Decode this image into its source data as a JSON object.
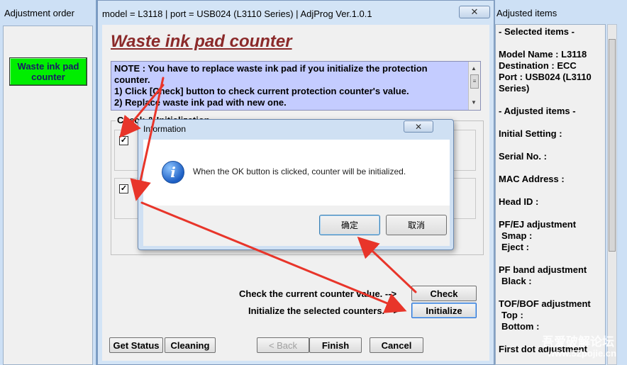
{
  "left_window": {
    "title": "Adjustment order",
    "button_label": "Waste ink pad counter"
  },
  "main_window": {
    "title": "model = L3118 | port = USB024 (L3110 Series) | AdjProg Ver.1.0.1",
    "close_symbol": "✕",
    "heading": "Waste ink pad counter",
    "note_lines": [
      "NOTE : You have to replace waste ink pad if you initialize the protection",
      "counter.",
      "1) Click [Check] button to check current protection counter's value.",
      "2) Replace waste ink pad with new one."
    ],
    "group_label": "Check & Initialization",
    "check_mark": "✓",
    "hint_check": "Check the current counter value. -->",
    "hint_initialize": "Initialize the selected counters. -->",
    "btn_check": "Check",
    "btn_initialize": "Initialize",
    "btn_get_status": "Get Status",
    "btn_cleaning": "Cleaning",
    "btn_back": "< Back",
    "btn_finish": "Finish",
    "btn_cancel": "Cancel"
  },
  "right_window": {
    "title": "Adjusted items",
    "selected_header": "- Selected items -",
    "model_name": "Model Name : L3118",
    "destination": "Destination : ECC",
    "port_line1": "Port : USB024 (L3110",
    "port_line2": "Series)",
    "adjusted_header": "- Adjusted items -",
    "initial_setting": "Initial Setting :",
    "serial_no": "Serial No. :",
    "mac_address": "MAC Address :",
    "head_id": "Head ID :",
    "pf_ej": "PF/EJ adjustment",
    "smap": "Smap :",
    "eject": "Eject :",
    "pf_band": "PF band adjustment",
    "black": "Black :",
    "tof_bof": "TOF/BOF adjustment",
    "top": "Top :",
    "bottom": "Bottom :",
    "first_dot": "First dot adjustment"
  },
  "dialog": {
    "title": "Information",
    "close_symbol": "✕",
    "message": "When the OK button is clicked, counter will be initialized.",
    "ok_label": "确定",
    "cancel_label": "取消",
    "icon": "info-icon",
    "icon_glyph": "i"
  },
  "watermark": {
    "text": "吾爱破解论坛",
    "url": "www.52pojie.cn"
  },
  "colors": {
    "annotation_arrow": "#e8352a",
    "left_button_green": "#00ee00",
    "note_background": "#c4ccff",
    "heading_red": "#8b2a2a"
  }
}
